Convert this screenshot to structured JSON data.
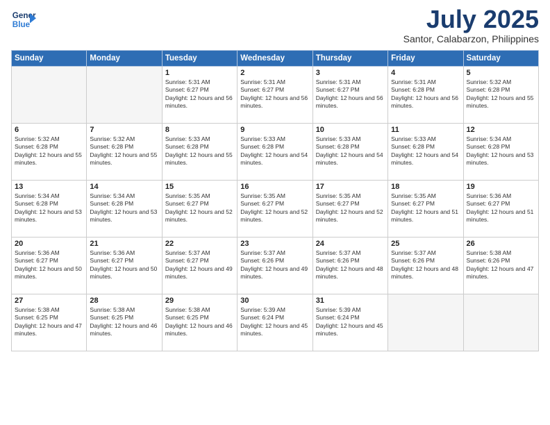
{
  "header": {
    "logo_line1": "General",
    "logo_line2": "Blue",
    "title": "July 2025",
    "location": "Santor, Calabarzon, Philippines"
  },
  "days_of_week": [
    "Sunday",
    "Monday",
    "Tuesday",
    "Wednesday",
    "Thursday",
    "Friday",
    "Saturday"
  ],
  "weeks": [
    [
      {
        "day": "",
        "sunrise": "",
        "sunset": "",
        "daylight": ""
      },
      {
        "day": "",
        "sunrise": "",
        "sunset": "",
        "daylight": ""
      },
      {
        "day": "1",
        "sunrise": "Sunrise: 5:31 AM",
        "sunset": "Sunset: 6:27 PM",
        "daylight": "Daylight: 12 hours and 56 minutes."
      },
      {
        "day": "2",
        "sunrise": "Sunrise: 5:31 AM",
        "sunset": "Sunset: 6:27 PM",
        "daylight": "Daylight: 12 hours and 56 minutes."
      },
      {
        "day": "3",
        "sunrise": "Sunrise: 5:31 AM",
        "sunset": "Sunset: 6:27 PM",
        "daylight": "Daylight: 12 hours and 56 minutes."
      },
      {
        "day": "4",
        "sunrise": "Sunrise: 5:31 AM",
        "sunset": "Sunset: 6:28 PM",
        "daylight": "Daylight: 12 hours and 56 minutes."
      },
      {
        "day": "5",
        "sunrise": "Sunrise: 5:32 AM",
        "sunset": "Sunset: 6:28 PM",
        "daylight": "Daylight: 12 hours and 55 minutes."
      }
    ],
    [
      {
        "day": "6",
        "sunrise": "Sunrise: 5:32 AM",
        "sunset": "Sunset: 6:28 PM",
        "daylight": "Daylight: 12 hours and 55 minutes."
      },
      {
        "day": "7",
        "sunrise": "Sunrise: 5:32 AM",
        "sunset": "Sunset: 6:28 PM",
        "daylight": "Daylight: 12 hours and 55 minutes."
      },
      {
        "day": "8",
        "sunrise": "Sunrise: 5:33 AM",
        "sunset": "Sunset: 6:28 PM",
        "daylight": "Daylight: 12 hours and 55 minutes."
      },
      {
        "day": "9",
        "sunrise": "Sunrise: 5:33 AM",
        "sunset": "Sunset: 6:28 PM",
        "daylight": "Daylight: 12 hours and 54 minutes."
      },
      {
        "day": "10",
        "sunrise": "Sunrise: 5:33 AM",
        "sunset": "Sunset: 6:28 PM",
        "daylight": "Daylight: 12 hours and 54 minutes."
      },
      {
        "day": "11",
        "sunrise": "Sunrise: 5:33 AM",
        "sunset": "Sunset: 6:28 PM",
        "daylight": "Daylight: 12 hours and 54 minutes."
      },
      {
        "day": "12",
        "sunrise": "Sunrise: 5:34 AM",
        "sunset": "Sunset: 6:28 PM",
        "daylight": "Daylight: 12 hours and 53 minutes."
      }
    ],
    [
      {
        "day": "13",
        "sunrise": "Sunrise: 5:34 AM",
        "sunset": "Sunset: 6:28 PM",
        "daylight": "Daylight: 12 hours and 53 minutes."
      },
      {
        "day": "14",
        "sunrise": "Sunrise: 5:34 AM",
        "sunset": "Sunset: 6:28 PM",
        "daylight": "Daylight: 12 hours and 53 minutes."
      },
      {
        "day": "15",
        "sunrise": "Sunrise: 5:35 AM",
        "sunset": "Sunset: 6:27 PM",
        "daylight": "Daylight: 12 hours and 52 minutes."
      },
      {
        "day": "16",
        "sunrise": "Sunrise: 5:35 AM",
        "sunset": "Sunset: 6:27 PM",
        "daylight": "Daylight: 12 hours and 52 minutes."
      },
      {
        "day": "17",
        "sunrise": "Sunrise: 5:35 AM",
        "sunset": "Sunset: 6:27 PM",
        "daylight": "Daylight: 12 hours and 52 minutes."
      },
      {
        "day": "18",
        "sunrise": "Sunrise: 5:35 AM",
        "sunset": "Sunset: 6:27 PM",
        "daylight": "Daylight: 12 hours and 51 minutes."
      },
      {
        "day": "19",
        "sunrise": "Sunrise: 5:36 AM",
        "sunset": "Sunset: 6:27 PM",
        "daylight": "Daylight: 12 hours and 51 minutes."
      }
    ],
    [
      {
        "day": "20",
        "sunrise": "Sunrise: 5:36 AM",
        "sunset": "Sunset: 6:27 PM",
        "daylight": "Daylight: 12 hours and 50 minutes."
      },
      {
        "day": "21",
        "sunrise": "Sunrise: 5:36 AM",
        "sunset": "Sunset: 6:27 PM",
        "daylight": "Daylight: 12 hours and 50 minutes."
      },
      {
        "day": "22",
        "sunrise": "Sunrise: 5:37 AM",
        "sunset": "Sunset: 6:27 PM",
        "daylight": "Daylight: 12 hours and 49 minutes."
      },
      {
        "day": "23",
        "sunrise": "Sunrise: 5:37 AM",
        "sunset": "Sunset: 6:26 PM",
        "daylight": "Daylight: 12 hours and 49 minutes."
      },
      {
        "day": "24",
        "sunrise": "Sunrise: 5:37 AM",
        "sunset": "Sunset: 6:26 PM",
        "daylight": "Daylight: 12 hours and 48 minutes."
      },
      {
        "day": "25",
        "sunrise": "Sunrise: 5:37 AM",
        "sunset": "Sunset: 6:26 PM",
        "daylight": "Daylight: 12 hours and 48 minutes."
      },
      {
        "day": "26",
        "sunrise": "Sunrise: 5:38 AM",
        "sunset": "Sunset: 6:26 PM",
        "daylight": "Daylight: 12 hours and 47 minutes."
      }
    ],
    [
      {
        "day": "27",
        "sunrise": "Sunrise: 5:38 AM",
        "sunset": "Sunset: 6:25 PM",
        "daylight": "Daylight: 12 hours and 47 minutes."
      },
      {
        "day": "28",
        "sunrise": "Sunrise: 5:38 AM",
        "sunset": "Sunset: 6:25 PM",
        "daylight": "Daylight: 12 hours and 46 minutes."
      },
      {
        "day": "29",
        "sunrise": "Sunrise: 5:38 AM",
        "sunset": "Sunset: 6:25 PM",
        "daylight": "Daylight: 12 hours and 46 minutes."
      },
      {
        "day": "30",
        "sunrise": "Sunrise: 5:39 AM",
        "sunset": "Sunset: 6:24 PM",
        "daylight": "Daylight: 12 hours and 45 minutes."
      },
      {
        "day": "31",
        "sunrise": "Sunrise: 5:39 AM",
        "sunset": "Sunset: 6:24 PM",
        "daylight": "Daylight: 12 hours and 45 minutes."
      },
      {
        "day": "",
        "sunrise": "",
        "sunset": "",
        "daylight": ""
      },
      {
        "day": "",
        "sunrise": "",
        "sunset": "",
        "daylight": ""
      }
    ]
  ]
}
